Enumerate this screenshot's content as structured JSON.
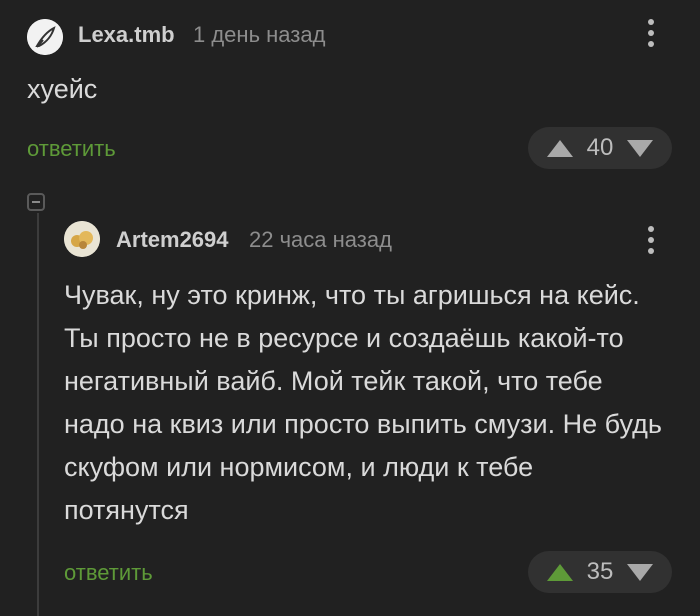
{
  "comments": [
    {
      "username": "Lexa.tmb",
      "time": "1 день назад",
      "text": "хуейс",
      "reply_label": "ответить",
      "votes": "40",
      "avatar_icon": "feather-icon",
      "upvote_active": false
    },
    {
      "username": "Artem2694",
      "time": "22 часа назад",
      "text": "Чувак, ну это кринж, что ты агришься на кейс. Ты просто не в ресурсе и создаёшь какой-то негативный вайб. Мой тейк такой, что тебе надо на квиз или просто выпить смузи. Не будь скуфом или нормисом, и люди к тебе потянутся",
      "reply_label": "ответить",
      "votes": "35",
      "avatar_icon": "user-avatar-icon",
      "upvote_active": true
    }
  ],
  "colors": {
    "background": "#212121",
    "accent_green": "#5e9a38",
    "vote_pill": "#313131"
  }
}
